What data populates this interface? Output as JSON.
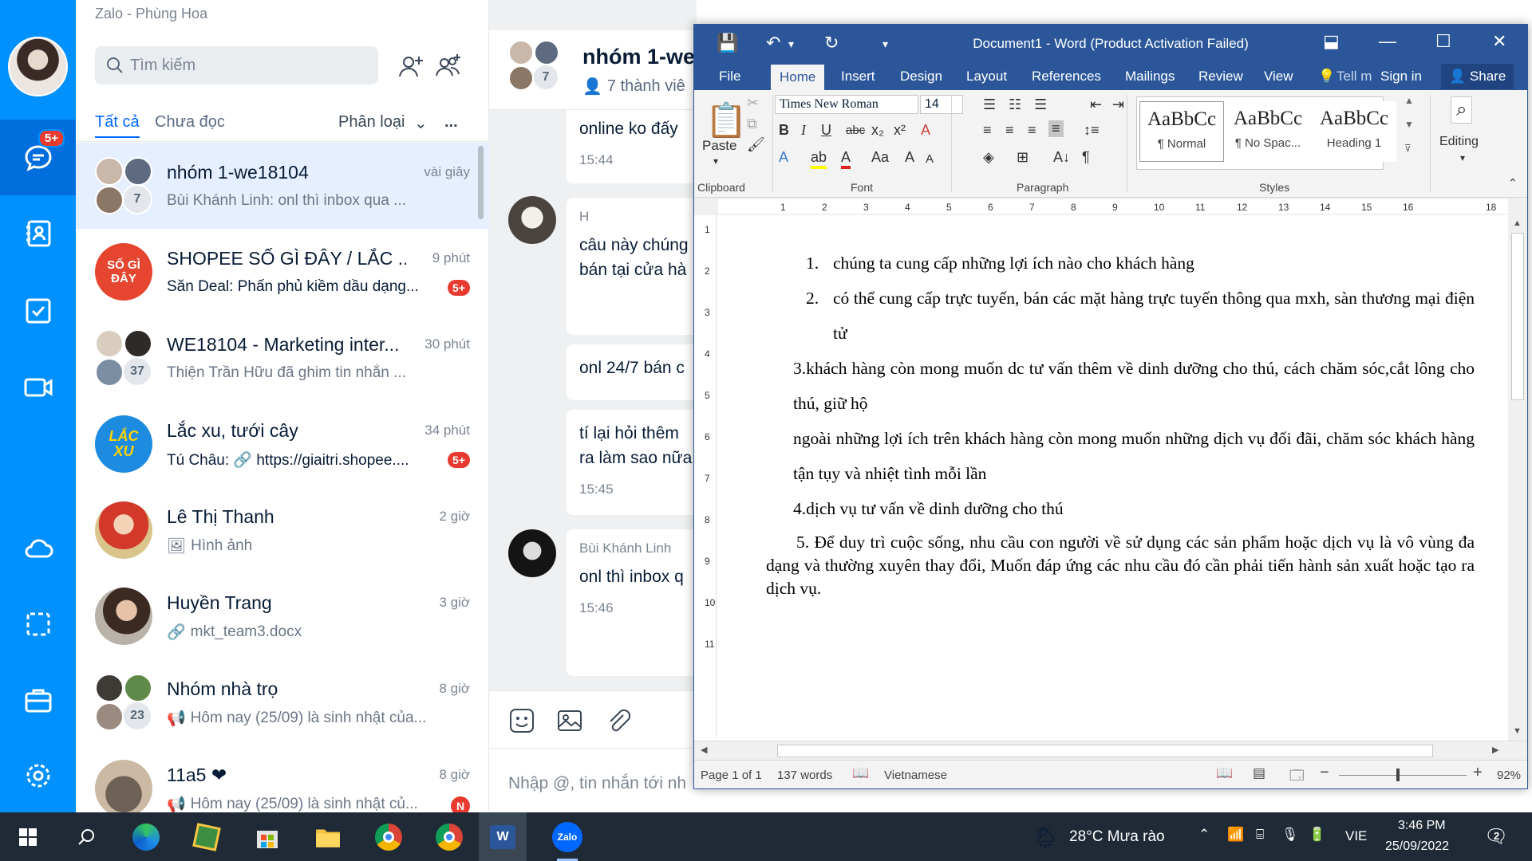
{
  "zalo": {
    "window_title": "Zalo - Phùng Hoa",
    "rail_badge": "5+",
    "search_placeholder": "Tìm kiếm",
    "tabs": {
      "all": "Tất cả",
      "unread": "Chưa đọc",
      "classify": "Phân loại",
      "more": "..."
    },
    "conversations": [
      {
        "name": "nhóm 1-we18104",
        "time": "vài giây",
        "preview": "Bùi Khánh Linh: onl thì inbox qua ...",
        "count": "7"
      },
      {
        "name": "SHOPEE SỐ GÌ ĐÂY / LẮC ...",
        "time": "9 phút",
        "preview": "Săn Deal: Phấn phủ kiềm dầu dạng...",
        "badge": "5+",
        "avatar_text": "SỐ GÌ ĐÂY"
      },
      {
        "name": "WE18104 - Marketing inter...",
        "time": "30 phút",
        "preview": "Thiện Trần Hữu đã ghim tin nhắn ...",
        "count": "37"
      },
      {
        "name": "Lắc xu, tưới cây",
        "time": "34 phút",
        "preview": "Tú Châu: 🔗 https://giaitri.shopee....",
        "badge": "5+",
        "avatar_text": "LẮC XU"
      },
      {
        "name": "Lê Thị Thanh",
        "time": "2 giờ",
        "preview": "Hình ảnh"
      },
      {
        "name": "Huyền Trang",
        "time": "3 giờ",
        "preview": "mkt_team3.docx"
      },
      {
        "name": "Nhóm nhà trọ",
        "time": "8 giờ",
        "preview": "Hôm nay (25/09) là sinh nhật của...",
        "count": "23"
      },
      {
        "name": "11a5 ❤",
        "time": "8 giờ",
        "preview": "Hôm nay (25/09) là sinh nhật củ...",
        "badge": "N"
      }
    ],
    "chat": {
      "title": "nhóm 1-we",
      "members": "7 thành viê",
      "messages": [
        {
          "text": "online ko đấy",
          "time": "15:44"
        },
        {
          "sender": "H",
          "text1": "câu này chúng",
          "text2": "bán tại cửa hà"
        },
        {
          "text": "onl 24/7 bán c"
        },
        {
          "text1": "tí lại hỏi thêm",
          "text2": "ra làm sao nữa",
          "time": "15:45"
        },
        {
          "sender": "Bùi Khánh Linh",
          "text": "onl thì inbox q",
          "time": "15:46"
        }
      ],
      "input_placeholder": "Nhập @, tin nhắn tới nh"
    }
  },
  "word": {
    "title": "Document1  -  Word (Product Activation Failed)",
    "menu": [
      "File",
      "Home",
      "Insert",
      "Design",
      "Layout",
      "References",
      "Mailings",
      "Review",
      "View"
    ],
    "tell_me": "Tell m",
    "sign_in": "Sign in",
    "share": "Share",
    "font_name": "Times New Roman",
    "font_size": "14",
    "paste": "Paste",
    "groups": {
      "clipboard": "Clipboard",
      "font": "Font",
      "paragraph": "Paragraph",
      "styles": "Styles"
    },
    "styles": [
      {
        "sample": "AaBbCc",
        "name": "¶ Normal"
      },
      {
        "sample": "AaBbCc",
        "name": "¶ No Spac..."
      },
      {
        "sample": "AaBbCc",
        "name": "Heading 1"
      }
    ],
    "editing": "Editing",
    "ruler_numbers": [
      "1",
      "2",
      "3",
      "4",
      "5",
      "6",
      "7",
      "8",
      "9",
      "10",
      "11",
      "12",
      "13",
      "14",
      "15",
      "16",
      "18"
    ],
    "vruler_numbers": [
      "1",
      "2",
      "3",
      "4",
      "5",
      "6",
      "7",
      "8",
      "9",
      "10",
      "11"
    ],
    "doc": {
      "p1_num": "1.",
      "p1": "chúng ta cung cấp những lợi ích nào cho khách hàng",
      "p2_num": "2.",
      "p2": "có thể cung cấp trực tuyến, bán các mặt hàng trực tuyến thông qua mxh, sàn thương mại điện tử",
      "p3": "3.khách hàng còn mong muốn dc tư vấn thêm về dinh dưỡng cho thú, cách chăm sóc,cắt lông cho thú, giữ hộ",
      "p4": "ngoài những lợi ích trên khách hàng còn mong muốn những dịch vụ đối đãi, chăm sóc khách hàng tận tụy và nhiệt tình mỗi lần",
      "p5": "4.dịch vụ tư vấn về dinh dưỡng cho thú",
      "p6": "5.  Để duy trì cuộc sống, nhu cầu con người về sử dụng các sản phẩm hoặc dịch vụ là vô vùng đa dạng và thường xuyên thay đổi, Muốn đáp ứng các nhu cầu đó cần phải tiến hành sản xuất hoặc tạo ra dịch vụ."
    },
    "status": {
      "page": "Page 1 of 1",
      "words": "137 words",
      "language": "Vietnamese",
      "zoom": "92%"
    }
  },
  "taskbar": {
    "weather": "28°C  Mưa rào",
    "lang": "VIE",
    "time": "3:46 PM",
    "date": "25/09/2022",
    "notif_count": "2"
  }
}
